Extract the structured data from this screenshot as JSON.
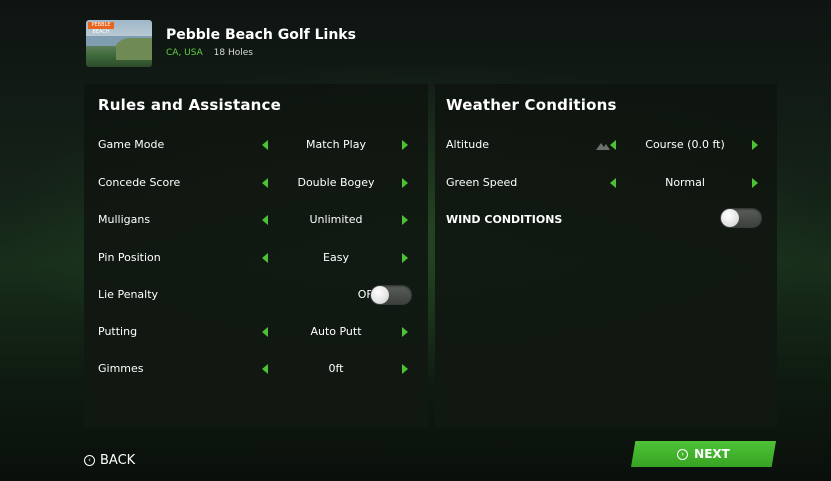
{
  "course": {
    "name": "Pebble Beach Golf Links",
    "location": "CA, USA",
    "holes": "18 Holes",
    "thumbnail_tag": "PEBBLE BEACH"
  },
  "rules": {
    "title": "Rules and Assistance",
    "rows": [
      {
        "label": "Game Mode",
        "value": "Match Play"
      },
      {
        "label": "Concede Score",
        "value": "Double Bogey"
      },
      {
        "label": "Mulligans",
        "value": "Unlimited"
      },
      {
        "label": "Pin Position",
        "value": "Easy"
      },
      {
        "label": "Lie Penalty",
        "value": "OFF"
      },
      {
        "label": "Putting",
        "value": "Auto Putt"
      },
      {
        "label": "Gimmes",
        "value": "0ft"
      }
    ]
  },
  "weather": {
    "title": "Weather Conditions",
    "rows": [
      {
        "label": "Altitude",
        "value": "Course (0.0 ft)"
      },
      {
        "label": "Green Speed",
        "value": "Normal"
      },
      {
        "label": "WIND CONDITIONS",
        "value": ""
      }
    ]
  },
  "footer": {
    "back_label": "BACK",
    "next_label": "NEXT"
  },
  "colors": {
    "accent": "#4cc234",
    "location_text": "#5fd142",
    "next_button": "#3fb02a"
  },
  "icons": {
    "back": "circle-chevron-icon",
    "next": "circle-chevron-icon",
    "arrow_left": "triangle-left-icon",
    "arrow_right": "triangle-right-icon",
    "altitude": "mountain-icon"
  }
}
